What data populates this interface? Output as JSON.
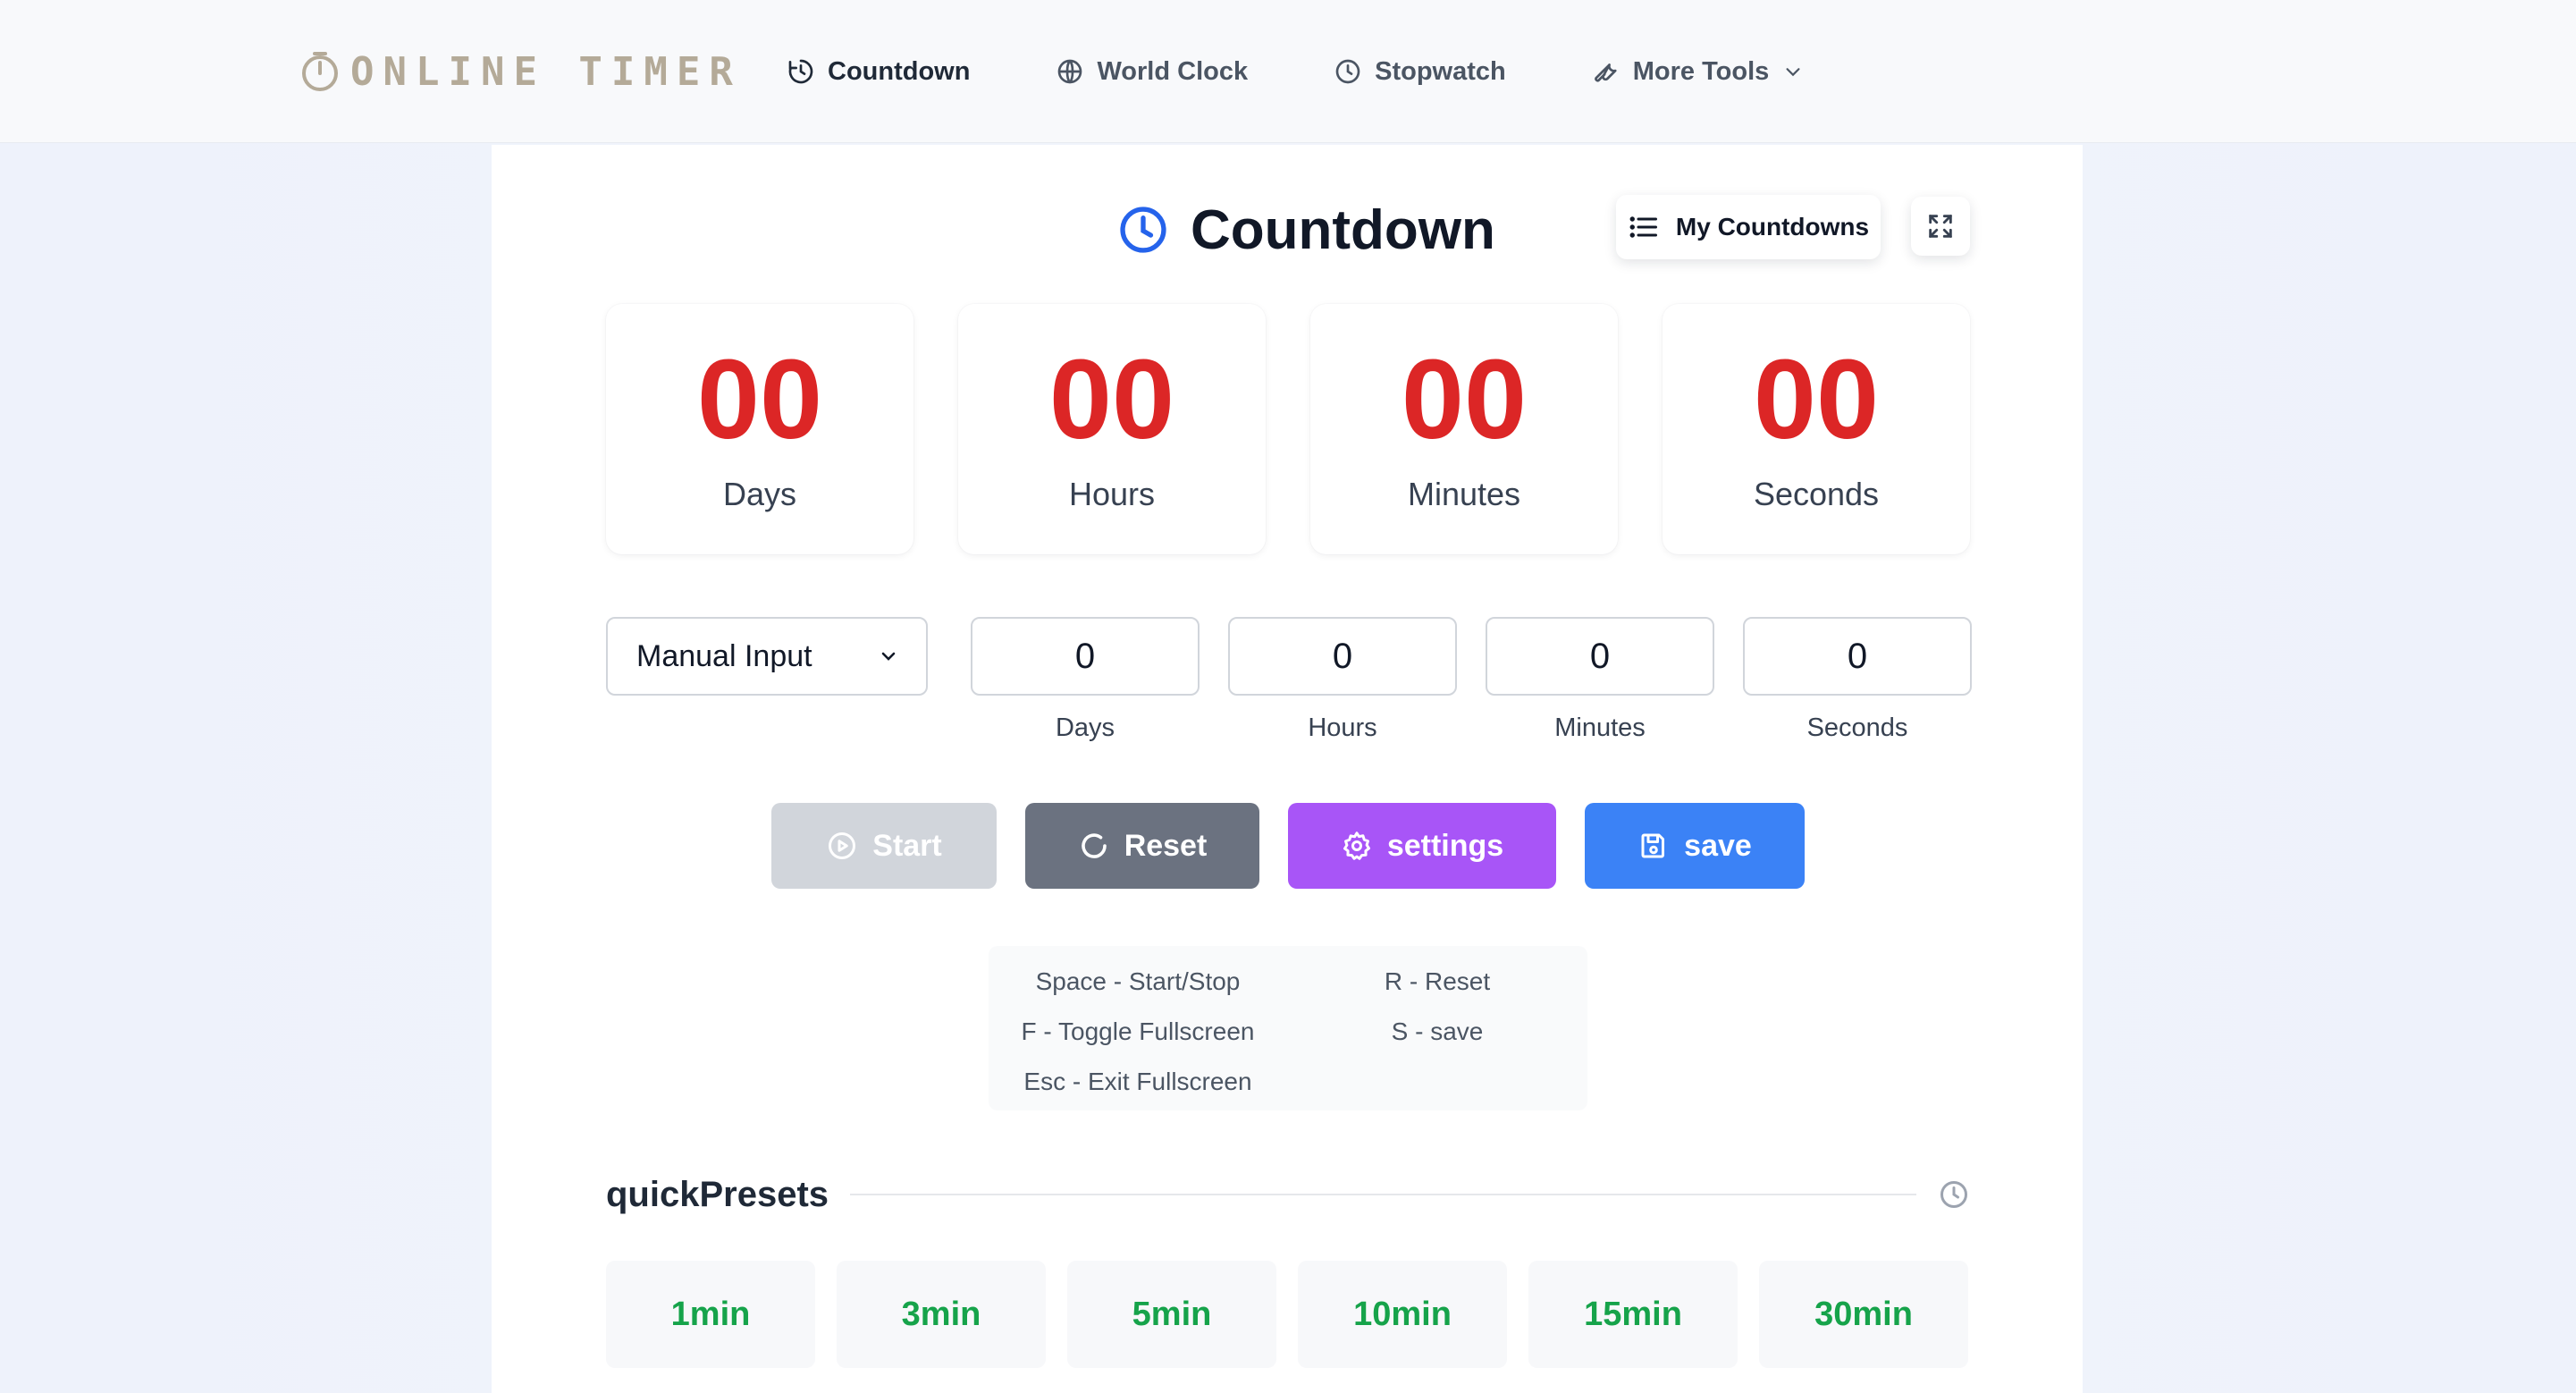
{
  "header": {
    "logo_text": "ONLINE TIMER",
    "nav": [
      {
        "label": "Countdown",
        "icon": "countdown-icon"
      },
      {
        "label": "World Clock",
        "icon": "globe-icon"
      },
      {
        "label": "Stopwatch",
        "icon": "clock-icon"
      },
      {
        "label": "More Tools",
        "icon": "wrench-icon"
      }
    ]
  },
  "main": {
    "title": "Countdown",
    "my_countdowns_label": "My Countdowns",
    "display": [
      {
        "value": "00",
        "label": "Days"
      },
      {
        "value": "00",
        "label": "Hours"
      },
      {
        "value": "00",
        "label": "Minutes"
      },
      {
        "value": "00",
        "label": "Seconds"
      }
    ],
    "mode_select": {
      "value": "Manual Input"
    },
    "inputs": [
      {
        "value": "0",
        "label": "Days"
      },
      {
        "value": "0",
        "label": "Hours"
      },
      {
        "value": "0",
        "label": "Minutes"
      },
      {
        "value": "0",
        "label": "Seconds"
      }
    ],
    "buttons": {
      "start": "Start",
      "reset": "Reset",
      "settings": "settings",
      "save": "save"
    },
    "shortcuts": [
      "Space - Start/Stop",
      "R - Reset",
      "F - Toggle Fullscreen",
      "S - save",
      "Esc - Exit Fullscreen"
    ],
    "presets_title": "quickPresets",
    "presets": [
      "1min",
      "3min",
      "5min",
      "10min",
      "15min",
      "30min"
    ]
  },
  "colors": {
    "digits": "#dc2626",
    "start_disabled": "#d1d5db",
    "reset": "#6b7280",
    "settings": "#a855f7",
    "save": "#3b82f6",
    "preset_text": "#16a34a",
    "title_icon": "#2563eb"
  }
}
